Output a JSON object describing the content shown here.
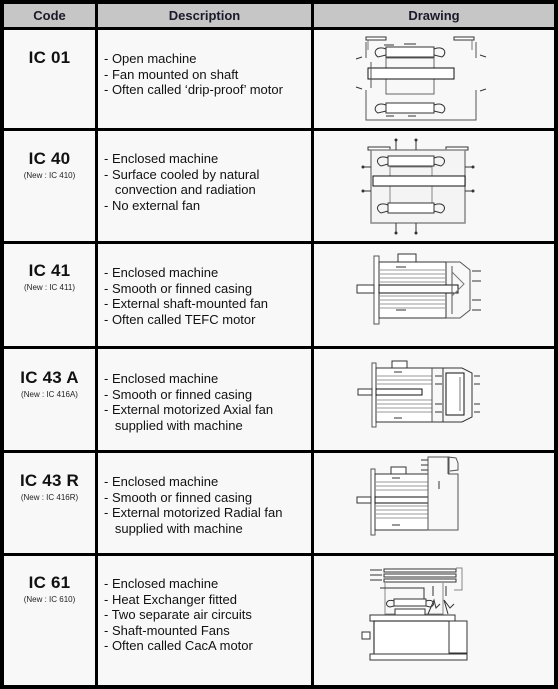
{
  "headers": {
    "code": "Code",
    "description": "Description",
    "drawing": "Drawing"
  },
  "rows": [
    {
      "code": "IC 01",
      "new_code": "",
      "description": [
        "- Open machine",
        "- Fan mounted on shaft",
        "- Often called ‘drip-proof’ motor"
      ],
      "drawing_icon": "open-machine-drawing"
    },
    {
      "code": "IC 40",
      "new_code": "(New : IC 410)",
      "description": [
        "- Enclosed machine",
        "- Surface cooled by natural",
        "   convection and radiation",
        "- No external fan"
      ],
      "drawing_icon": "natural-convection-drawing"
    },
    {
      "code": "IC 41",
      "new_code": "(New : IC 411)",
      "description": [
        "- Enclosed machine",
        "- Smooth or finned casing",
        "- External shaft-mounted fan",
        "- Often called TEFC motor"
      ],
      "drawing_icon": "tefc-motor-drawing"
    },
    {
      "code": "IC 43 A",
      "new_code": "(New : IC 416A)",
      "description": [
        "- Enclosed machine",
        "- Smooth or finned casing",
        "- External motorized Axial fan",
        "   supplied with machine"
      ],
      "drawing_icon": "axial-fan-motor-drawing"
    },
    {
      "code": "IC 43 R",
      "new_code": "(New : IC 416R)",
      "description": [
        "- Enclosed machine",
        "- Smooth or finned casing",
        "- External motorized Radial fan",
        "   supplied with machine"
      ],
      "drawing_icon": "radial-fan-motor-drawing"
    },
    {
      "code": "IC 61",
      "new_code": "(New : IC 610)",
      "description": [
        "- Enclosed machine",
        "- Heat Exchanger fitted",
        "- Two separate air circuits",
        "- Shaft-mounted Fans",
        "- Often called CacA motor"
      ],
      "drawing_icon": "heat-exchanger-motor-drawing"
    }
  ],
  "colors": {
    "header_bg": "#c6c6c6",
    "cell_bg": "#f8f8f8",
    "border": "#000000"
  }
}
